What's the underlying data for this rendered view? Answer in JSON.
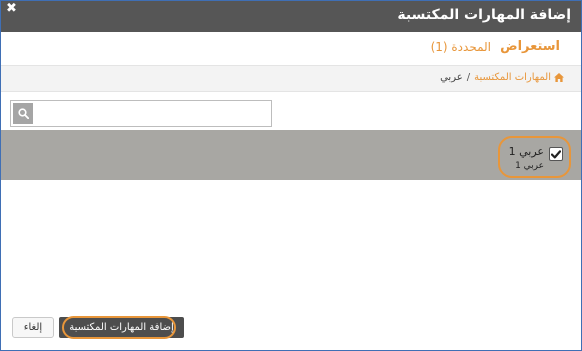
{
  "dialog": {
    "title": "إضافة المهارات المكتسبة",
    "close_icon": "close-icon"
  },
  "tabs": [
    {
      "label": "استعراض",
      "active": true
    },
    {
      "label": "المحددة (1)",
      "active": false
    }
  ],
  "breadcrumb": {
    "home_icon": "home-icon",
    "home_label": "المهارات المكتسبة",
    "separator": "/",
    "current": "عربي"
  },
  "search": {
    "value": "",
    "placeholder": "",
    "icon": "search-icon"
  },
  "results": [
    {
      "name": "عربي 1",
      "subtitle": "عربي 1",
      "checked": true
    }
  ],
  "footer": {
    "cancel_label": "إلغاء",
    "add_label": "إضافة المهارات المكتسبة"
  },
  "colors": {
    "accent": "#e8963a",
    "titlebar": "#565656",
    "row_selected": "#a8a7a3",
    "primary_button": "#4d4d4d"
  }
}
